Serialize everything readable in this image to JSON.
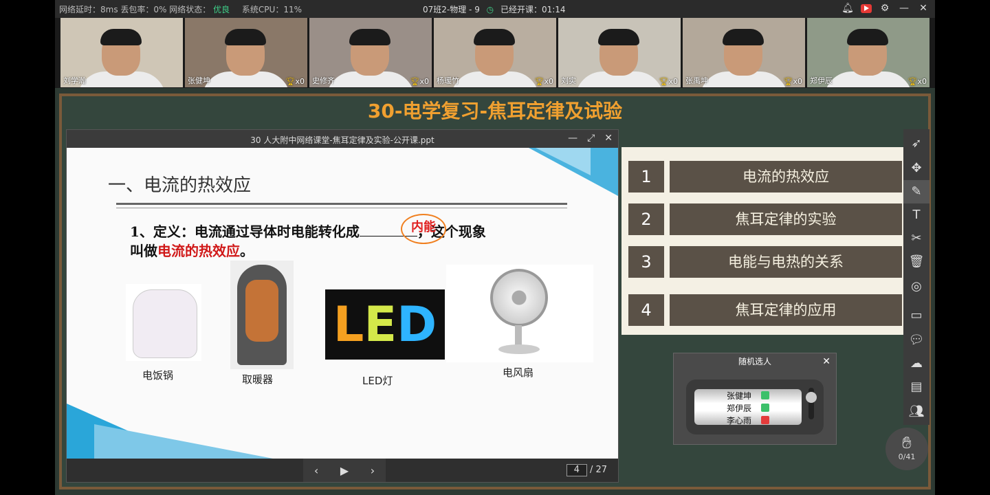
{
  "topbar": {
    "stats_label": "网络延时：8ms 丢包率：0% 网络状态：",
    "network_status": "优良",
    "cpu": "系统CPU：11%",
    "class_name": "07班2-物理 - 9",
    "started": "已经开课：01:14"
  },
  "videos": [
    {
      "name": "刘学瀚",
      "score": ""
    },
    {
      "name": "张健坤",
      "score": "x0"
    },
    {
      "name": "史修齐",
      "score": "x0"
    },
    {
      "name": "杨瑷竹",
      "score": "x0"
    },
    {
      "name": "刘实",
      "score": "x0"
    },
    {
      "name": "张禹坤",
      "score": "x0"
    },
    {
      "name": "郑伊辰",
      "score": "x0"
    }
  ],
  "board": {
    "title": "30-电学复习-焦耳定律及试验"
  },
  "ppt": {
    "window_title": "30 人大附中网络课堂-焦耳定律及实验-公开课.ppt",
    "heading": "一、电流的热效应",
    "def_part1": "1、定义：电流通过导体时电能转化成",
    "def_part2": "，这个现象",
    "def_part3": "叫做",
    "def_red": "电流的热效应",
    "def_end": "。",
    "handnote": "内能",
    "led_text_l": "L",
    "led_text_e": "E",
    "led_text_d": "D",
    "captions": [
      "电饭锅",
      "取暖器",
      "LED灯",
      "电风扇"
    ],
    "page_current": "4",
    "page_total": "/ 27"
  },
  "agenda": [
    {
      "num": "1",
      "label": "电流的热效应"
    },
    {
      "num": "2",
      "label": "焦耳定律的实验"
    },
    {
      "num": "3",
      "label": "电能与电热的关系"
    },
    {
      "num": "4",
      "label": "焦耳定律的应用"
    }
  ],
  "picker": {
    "title": "随机选人",
    "names": [
      "张健坤",
      "郑伊辰",
      "李心雨"
    ],
    "tag_colors": [
      "#3cc06a",
      "#3cc06a",
      "#e33b3b"
    ]
  },
  "hand": {
    "count": "0/41"
  }
}
